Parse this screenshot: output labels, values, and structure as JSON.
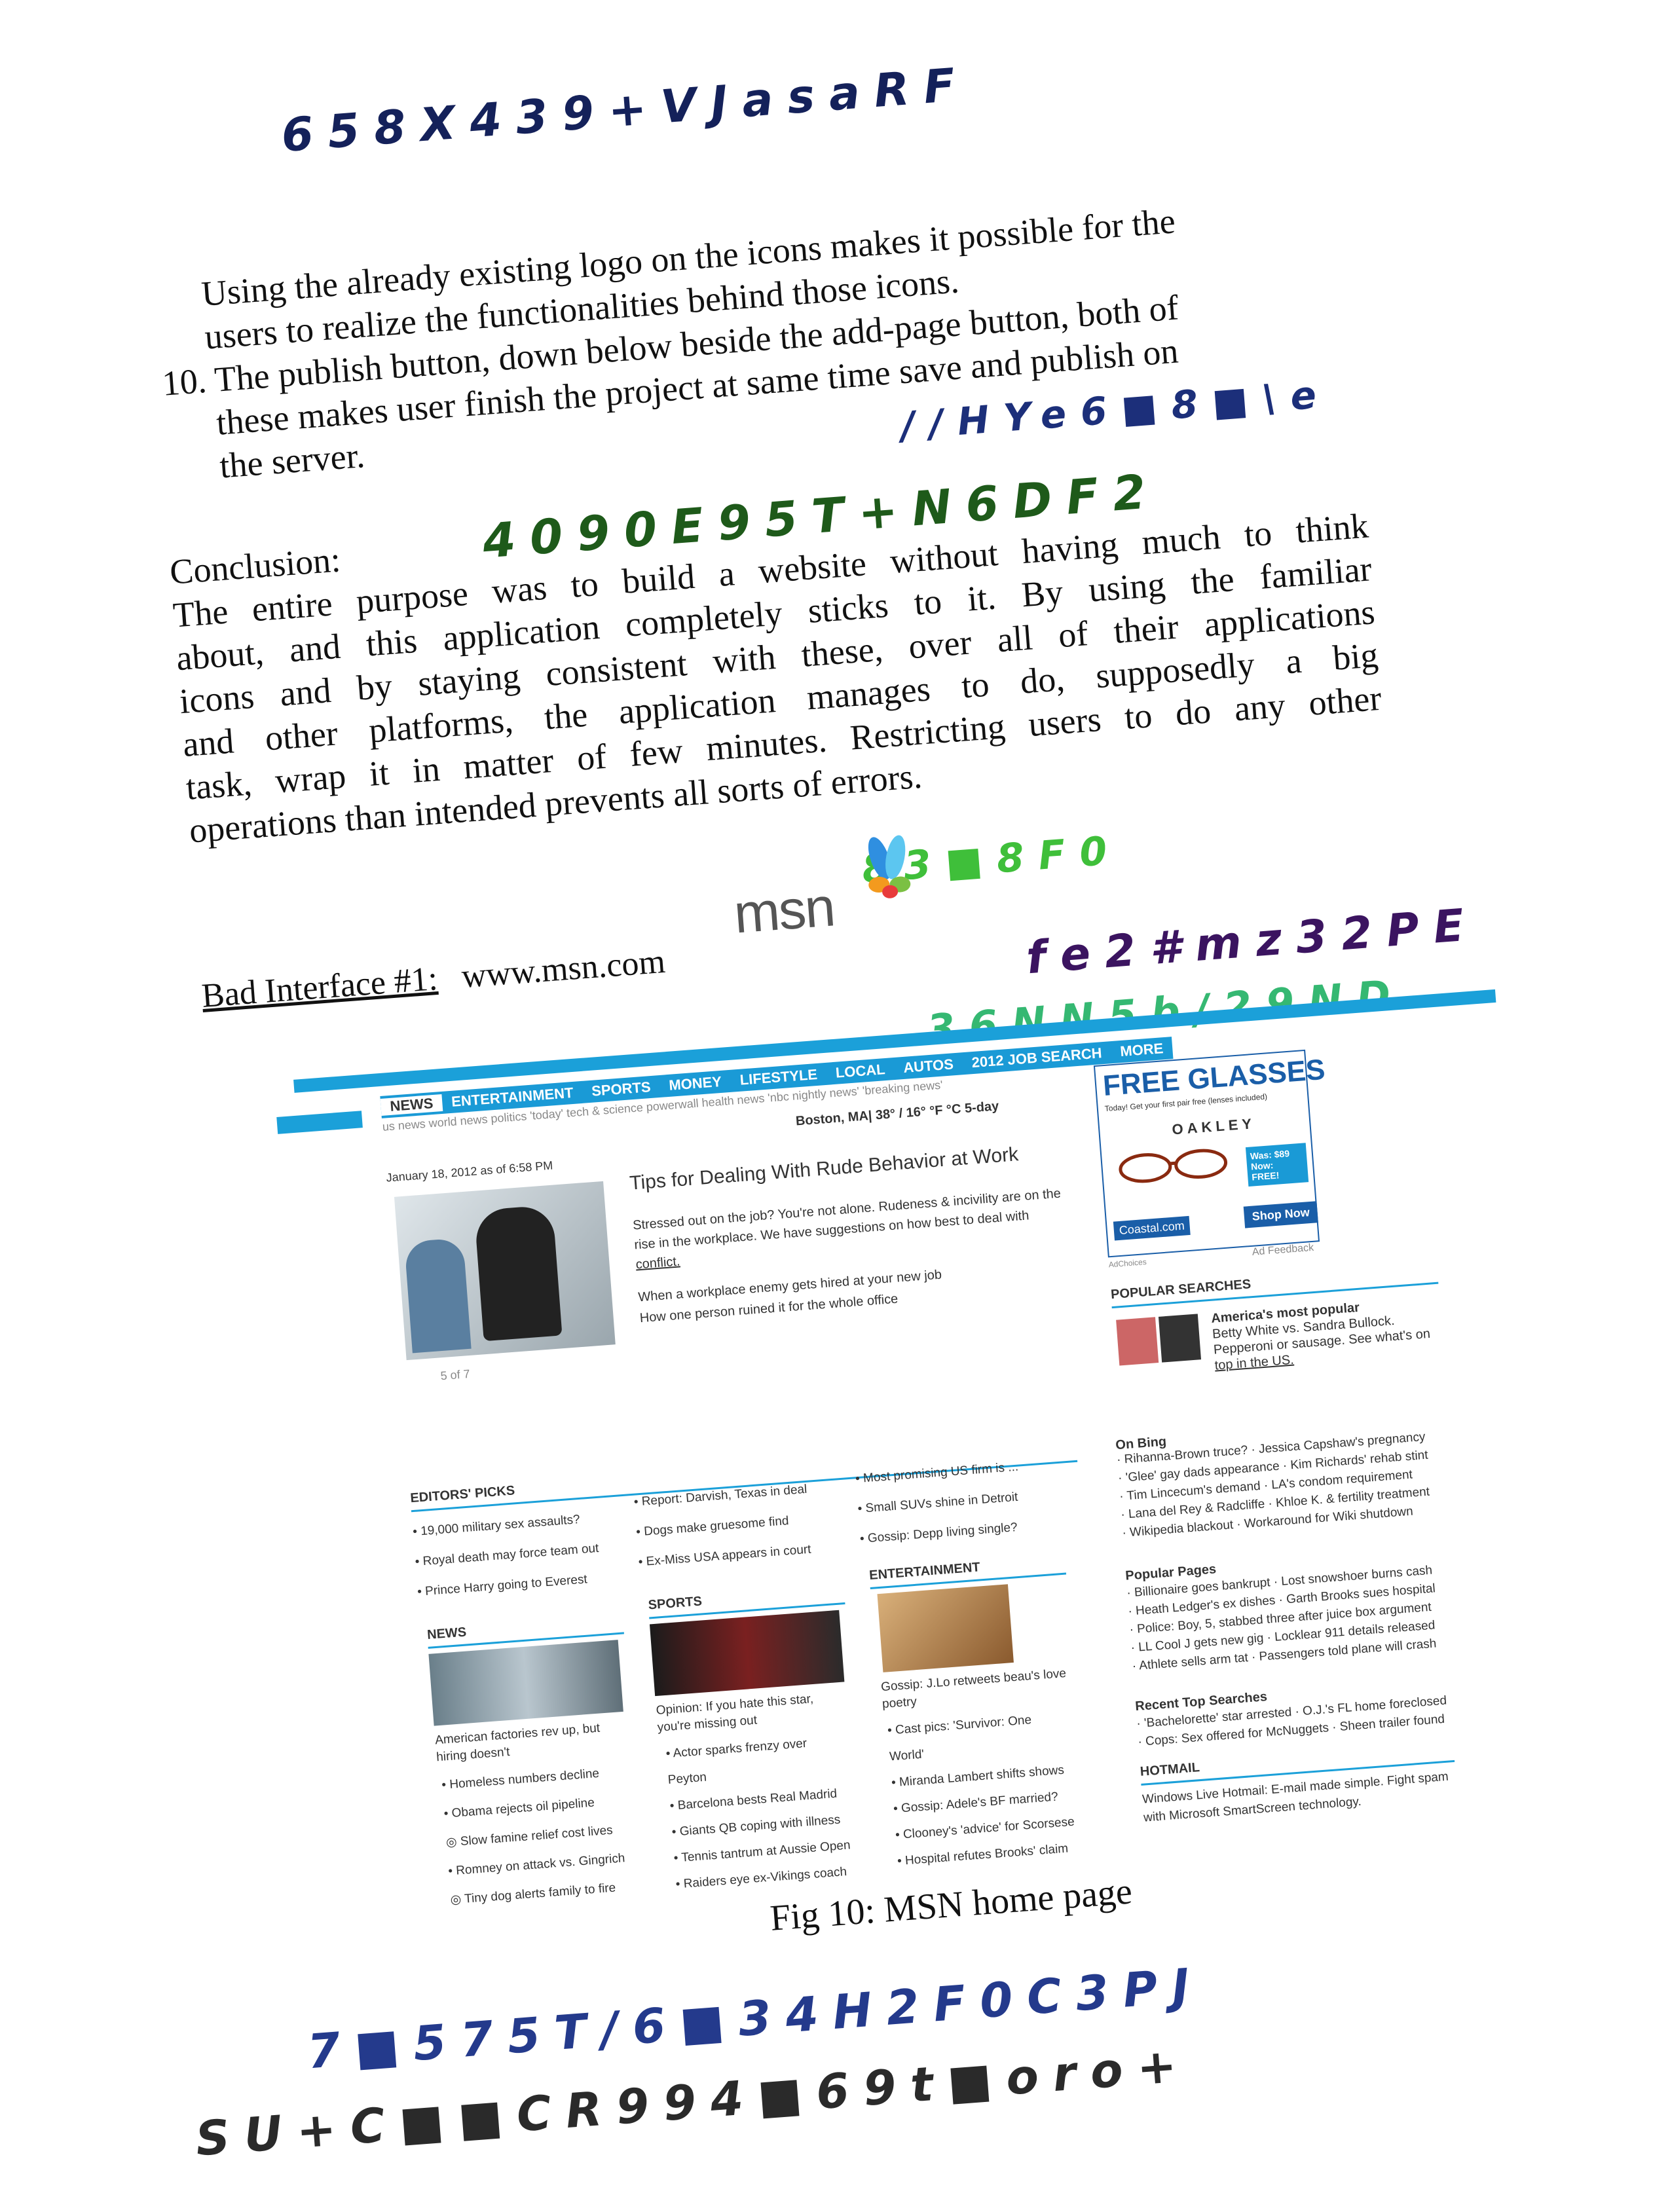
{
  "handwriting": {
    "line1": "658X439+VJasaRF",
    "line2": "//HYe6■8■\\e",
    "line3": "4090E95T+N6DF2",
    "line4": "83■8F0",
    "line5": "fe2#mz32PE",
    "line6": "36NN5b/29ND",
    "line7": "7■575T/6■34H2F0C3PJ",
    "line8": "SU+C■■CR994■69t■oro+"
  },
  "body": {
    "para1a": "Using the already existing logo on the icons makes it possible for the",
    "para1b": "users to realize the functionalities behind those icons.",
    "item10a": "10. The publish button, down below beside the add-page button, both of",
    "item10b": "these makes user finish the project at same time save and publish on",
    "item10c": "the server.",
    "conclusion_label": "Conclusion:",
    "conclusion_lines": [
      "The entire purpose was to build a website without having much to think",
      "about, and this application completely sticks to it. By using the familiar",
      "icons and by staying consistent with these, over all of their applications",
      "and other platforms, the application manages to do, supposedly a big",
      "task, wrap it in matter of few minutes. Restricting users to do any other",
      "operations than intended prevents all sorts of errors."
    ],
    "bad_interface_label": "Bad Interface #1:",
    "bad_interface_url": "www.msn.com",
    "msn_logo": "msn",
    "figure_caption": "Fig 10: MSN home page"
  },
  "msn": {
    "nav": [
      "NEWS",
      "ENTERTAINMENT",
      "SPORTS",
      "MONEY",
      "LIFESTYLE",
      "LOCAL",
      "AUTOS",
      "2012 JOB SEARCH",
      "MORE"
    ],
    "subnav": "us news   world news   politics   'today'   tech & science   powerwall   health news   'nbc nightly news'   'breaking news'",
    "weather": "Boston, MA|  38° / 16°  °F °C  5-day",
    "date": "January 18, 2012 as of 6:58 PM",
    "headline": "Tips for Dealing With Rude Behavior at Work",
    "story_lines": [
      "Stressed out on the job? You're not alone. Rudeness & incivility are on the",
      "rise in the workplace. We have suggestions on how best to deal with",
      "conflict."
    ],
    "story_links": [
      "When a workplace enemy gets hired at your new job",
      "How one person ruined it for the whole office"
    ],
    "pager": "5 of 7",
    "ad": {
      "title": "FREE GLASSES",
      "sub": "Today! Get your first pair free (lenses included)",
      "brand": "OAKLEY",
      "price": "Was: $89 Now: FREE!",
      "shop": "Shop Now",
      "site": "Coastal.com",
      "choices": "AdChoices",
      "feedback": "Ad Feedback"
    },
    "popular_searches": {
      "title": "POPULAR SEARCHES",
      "lines": [
        "America's most popular",
        "Betty White vs. Sandra Bullock.",
        "Pepperoni or sausage. See what's on",
        "top in the US."
      ]
    },
    "editors_picks": {
      "title": "EDITORS' PICKS",
      "col1": [
        "• 19,000 military sex assaults?",
        "• Royal death may force team out",
        "• Prince Harry going to Everest"
      ],
      "col2": [
        "• Report: Darvish, Texas in deal",
        "• Dogs make gruesome find",
        "• Ex-Miss USA appears in court"
      ],
      "col3": [
        "• Most promising US firm is ...",
        "• Small SUVs shine in Detroit",
        "• Gossip: Depp living single?"
      ]
    },
    "on_bing": {
      "title": "On Bing",
      "lines": [
        "· Rihanna-Brown truce?  · Jessica Capshaw's pregnancy",
        "· 'Glee' gay dads appearance  · Kim Richards' rehab stint",
        "· Tim Lincecum's demand  · LA's condom requirement",
        "· Lana del Rey & Radcliffe  · Khloe K. & fertility treatment",
        "· Wikipedia blackout  · Workaround for Wiki shutdown"
      ]
    },
    "popular_pages": {
      "title": "Popular Pages",
      "lines": [
        "· Billionaire goes bankrupt  · Lost snowshoer burns cash",
        "· Heath Ledger's ex dishes  · Garth Brooks sues hospital",
        "· Police: Boy, 5, stabbed three after juice box argument",
        "· LL Cool J gets new gig  · Locklear 911 details released",
        "· Athlete sells arm tat  · Passengers told plane will crash"
      ]
    },
    "recent_searches": {
      "title": "Recent Top Searches",
      "lines": [
        "· 'Bachelorette' star arrested  · O.J.'s FL home foreclosed",
        "· Cops: Sex offered for McNuggets  · Sheen trailer found"
      ]
    },
    "hotmail": {
      "title": "HOTMAIL",
      "lines": [
        "Windows Live Hotmail: E-mail made simple. Fight spam",
        "with Microsoft SmartScreen technology."
      ]
    },
    "news": {
      "title": "NEWS",
      "caption": [
        "American factories rev up, but",
        "hiring doesn't"
      ],
      "items": [
        "•  Homeless numbers decline",
        "•  Obama rejects oil pipeline",
        "◎  Slow famine relief cost lives",
        "•  Romney on attack vs. Gingrich",
        "◎  Tiny dog alerts family to fire"
      ]
    },
    "sports": {
      "title": "SPORTS",
      "caption": [
        "Opinion: If you hate this star,",
        "you're missing out"
      ],
      "items": [
        "•  Actor sparks frenzy over",
        "    Peyton",
        "•  Barcelona bests Real Madrid",
        "•  Giants QB coping with illness",
        "•  Tennis tantrum at Aussie Open",
        "•  Raiders eye ex-Vikings coach"
      ]
    },
    "entertainment": {
      "title": "ENTERTAINMENT",
      "caption": [
        "Gossip: J.Lo retweets beau's love",
        "poetry"
      ],
      "items": [
        "•  Cast pics: 'Survivor: One",
        "    World'",
        "•  Miranda Lambert shifts shows",
        "•  Gossip: Adele's BF married?",
        "•  Clooney's 'advice' for Scorsese",
        "•  Hospital refutes Brooks' claim"
      ]
    },
    "colors": {
      "accent": "#1a9ad6",
      "ad_blue": "#1a5ea8"
    }
  }
}
